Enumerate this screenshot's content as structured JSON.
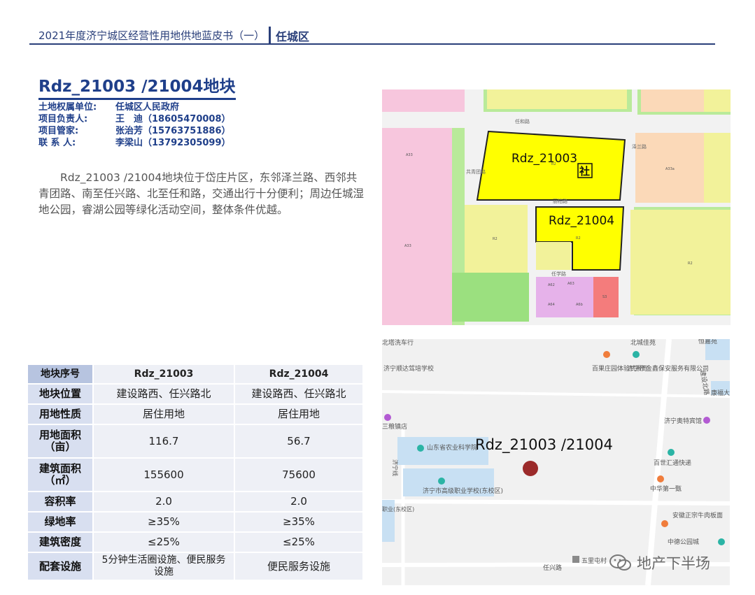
{
  "header": {
    "title": "2021年度济宁城区经营性用地供地蓝皮书（一）",
    "district": "任城区"
  },
  "parcel": {
    "title": "Rdz_21003 /21004地块",
    "info": [
      {
        "key": "土地权属单位:",
        "value": "任城区人民政府"
      },
      {
        "key": "项目负责人:",
        "value": "王　迪（18605470008）"
      },
      {
        "key": "项目管家:",
        "value": "张治芳（15763751886）"
      },
      {
        "key": "联 系 人:",
        "value": "李梁山（13792305099）"
      }
    ],
    "description": "Rdz_21003 /21004地块位于岱庄片区，东邻泽兰路、西邻共青团路、南至任兴路、北至任和路，交通出行十分便利；周边任城湿地公园，睿湖公园等绿化活动空间，整体条件优越。"
  },
  "table": {
    "headers": [
      "地块序号",
      "Rdz_21003",
      "Rdz_21004"
    ],
    "rows": [
      [
        "地块位置",
        "建设路西、任兴路北",
        "建设路西、任兴路北"
      ],
      [
        "用地性质",
        "居住用地",
        "居住用地"
      ],
      [
        "用地面积（亩）",
        "116.7",
        "56.7"
      ],
      [
        "建筑面积（㎡）",
        "155600",
        "75600"
      ],
      [
        "容积率",
        "2.0",
        "2.0"
      ],
      [
        "绿地率",
        "≥35%",
        "≥35%"
      ],
      [
        "建筑密度",
        "≤25%",
        "≤25%"
      ],
      [
        "配套设施",
        "5分钟生活圈设施、便民服务设施",
        "便民服务设施"
      ]
    ]
  },
  "plan_map": {
    "parcel_a": "Rdz_21003",
    "parcel_b": "Rdz_21004",
    "badge": "社",
    "labels": [
      "任和路",
      "泽兰路",
      "共青团路",
      "丽柏路",
      "任学路",
      "R2",
      "A33",
      "A33a",
      "R2",
      "A33",
      "R2",
      "R2",
      "A62",
      "A63",
      "A64",
      "A6b",
      "S3"
    ],
    "colors": {
      "residential": "#ffff66",
      "pink": "#f7c6dd",
      "green": "#9be07f",
      "lightyellow": "#f2f29a",
      "purple": "#e6b2ea",
      "red": "#f47c7c",
      "peach": "#fbd9b8"
    }
  },
  "location_map": {
    "label": "Rdz_21003 /21004",
    "pois": [
      "北塔洗车行",
      "济宁顺达驾培学校",
      "三粮镇店",
      "山东省农业科学院",
      "济宁市高级职业学校(东校区)",
      "北城佳苑",
      "百果庄园体验式餐厅",
      "济宁市金鑫保安服务有限公司",
      "康福大",
      "济宁奥特宾馆",
      "百世汇通快递",
      "中华第一甄",
      "安徽正宗牛肉板面",
      "中德公园城",
      "五里屯村",
      "恒嘉苑",
      "建设北路",
      "任兴路",
      "济宁线",
      "职业(东校区)"
    ],
    "marker_color": "#9b2a2a"
  },
  "watermark": "地产下半场"
}
